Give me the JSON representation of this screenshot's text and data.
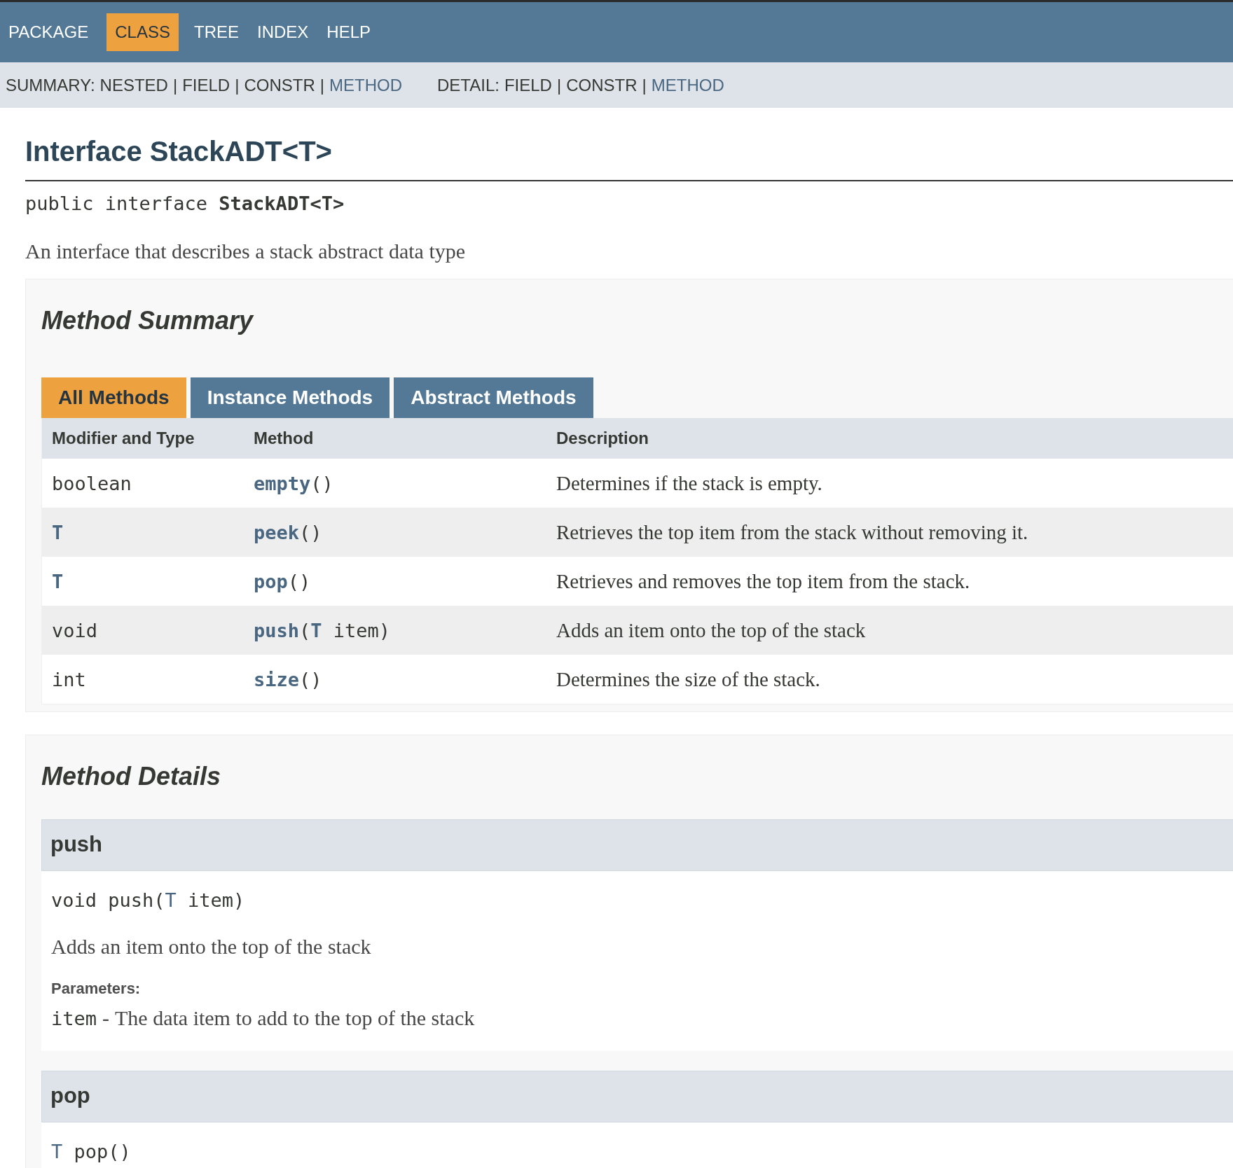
{
  "nav": {
    "items": [
      {
        "label": "PACKAGE",
        "selected": false
      },
      {
        "label": "CLASS",
        "selected": true
      },
      {
        "label": "TREE",
        "selected": false
      },
      {
        "label": "INDEX",
        "selected": false
      },
      {
        "label": "HELP",
        "selected": false
      }
    ]
  },
  "subnav": {
    "separator": "|",
    "groups": [
      {
        "label": "SUMMARY:",
        "items": [
          {
            "text": "NESTED",
            "link": false
          },
          {
            "text": "FIELD",
            "link": false
          },
          {
            "text": "CONSTR",
            "link": false
          },
          {
            "text": "METHOD",
            "link": true
          }
        ]
      },
      {
        "label": "DETAIL:",
        "items": [
          {
            "text": "FIELD",
            "link": false
          },
          {
            "text": "CONSTR",
            "link": false
          },
          {
            "text": "METHOD",
            "link": true
          }
        ]
      }
    ]
  },
  "title": "Interface StackADT<T>",
  "signature": [
    {
      "text": "public interface ",
      "kind": "plain"
    },
    {
      "text": "StackADT<T>",
      "kind": "strong"
    }
  ],
  "description": "An interface that describes a stack abstract data type",
  "method_summary": {
    "heading": "Method Summary",
    "tabs": [
      {
        "label": "All Methods",
        "selected": true
      },
      {
        "label": "Instance Methods",
        "selected": false
      },
      {
        "label": "Abstract Methods",
        "selected": false
      }
    ],
    "columns": [
      "Modifier and Type",
      "Method",
      "Description"
    ],
    "rows": [
      {
        "type": [
          {
            "text": "boolean",
            "kind": "plain"
          }
        ],
        "method": [
          {
            "text": "empty",
            "kind": "link"
          },
          {
            "text": "()",
            "kind": "plain"
          }
        ],
        "description": "Determines if the stack is empty."
      },
      {
        "type": [
          {
            "text": "T",
            "kind": "link"
          }
        ],
        "method": [
          {
            "text": "peek",
            "kind": "link"
          },
          {
            "text": "()",
            "kind": "plain"
          }
        ],
        "description": "Retrieves the top item from the stack without removing it."
      },
      {
        "type": [
          {
            "text": "T",
            "kind": "link"
          }
        ],
        "method": [
          {
            "text": "pop",
            "kind": "link"
          },
          {
            "text": "()",
            "kind": "plain"
          }
        ],
        "description": "Retrieves and removes the top item from the stack."
      },
      {
        "type": [
          {
            "text": "void",
            "kind": "plain"
          }
        ],
        "method": [
          {
            "text": "push",
            "kind": "link"
          },
          {
            "text": "(",
            "kind": "plain"
          },
          {
            "text": "T",
            "kind": "link"
          },
          {
            "text": " item)",
            "kind": "plain"
          }
        ],
        "description": "Adds an item onto the top of the stack"
      },
      {
        "type": [
          {
            "text": "int",
            "kind": "plain"
          }
        ],
        "method": [
          {
            "text": "size",
            "kind": "link"
          },
          {
            "text": "()",
            "kind": "plain"
          }
        ],
        "description": "Determines the size of the stack."
      }
    ]
  },
  "method_details": {
    "heading": "Method Details",
    "methods": [
      {
        "name": "push",
        "signature": [
          {
            "text": "void push(",
            "kind": "plain"
          },
          {
            "text": "T",
            "kind": "link"
          },
          {
            "text": " item)",
            "kind": "plain"
          }
        ],
        "description": "Adds an item onto the top of the stack",
        "params_label": "Parameters:",
        "params": [
          {
            "name": "item",
            "separator": "-",
            "description": "The data item to add to the top of the stack"
          }
        ]
      },
      {
        "name": "pop",
        "signature": [
          {
            "text": "T",
            "kind": "link"
          },
          {
            "text": " pop()",
            "kind": "plain"
          }
        ]
      }
    ]
  }
}
